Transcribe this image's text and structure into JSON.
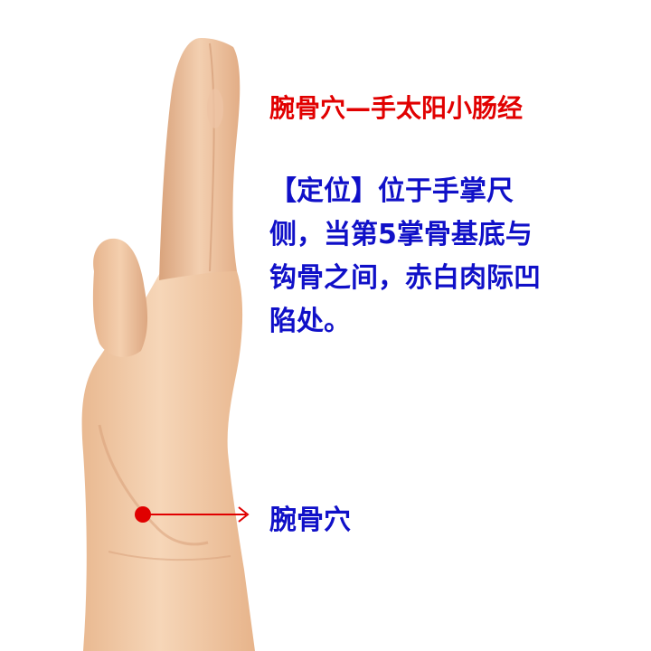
{
  "title": "腕骨穴—手太阳小肠经",
  "description": {
    "lines": [
      "【定位】位于手掌尺",
      "侧，当第5掌骨基底与",
      "钩骨之间，赤白肉际凹",
      "陷处。"
    ]
  },
  "point_label": "腕骨穴",
  "colors": {
    "title": "#e10000",
    "description": "#1010c8",
    "point_label": "#1010c8",
    "acupoint_marker": "#e00000",
    "pointer_line": "#e00000",
    "skin": "#f0c8a4"
  }
}
